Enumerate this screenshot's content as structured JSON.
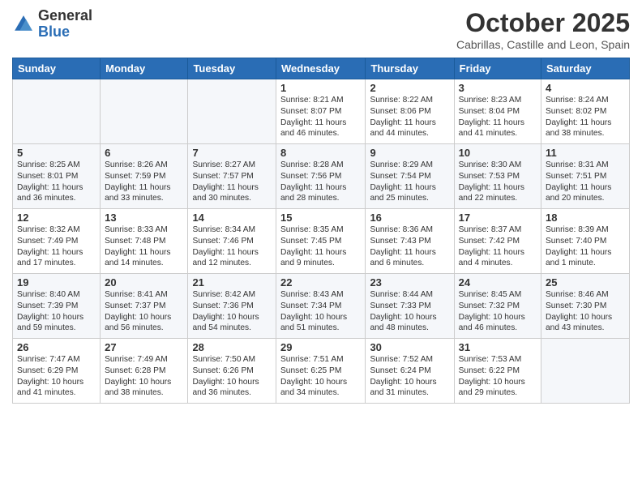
{
  "logo": {
    "general": "General",
    "blue": "Blue"
  },
  "header": {
    "title": "October 2025",
    "subtitle": "Cabrillas, Castille and Leon, Spain"
  },
  "weekdays": [
    "Sunday",
    "Monday",
    "Tuesday",
    "Wednesday",
    "Thursday",
    "Friday",
    "Saturday"
  ],
  "weeks": [
    [
      {
        "day": "",
        "info": ""
      },
      {
        "day": "",
        "info": ""
      },
      {
        "day": "",
        "info": ""
      },
      {
        "day": "1",
        "info": "Sunrise: 8:21 AM\nSunset: 8:07 PM\nDaylight: 11 hours and 46 minutes."
      },
      {
        "day": "2",
        "info": "Sunrise: 8:22 AM\nSunset: 8:06 PM\nDaylight: 11 hours and 44 minutes."
      },
      {
        "day": "3",
        "info": "Sunrise: 8:23 AM\nSunset: 8:04 PM\nDaylight: 11 hours and 41 minutes."
      },
      {
        "day": "4",
        "info": "Sunrise: 8:24 AM\nSunset: 8:02 PM\nDaylight: 11 hours and 38 minutes."
      }
    ],
    [
      {
        "day": "5",
        "info": "Sunrise: 8:25 AM\nSunset: 8:01 PM\nDaylight: 11 hours and 36 minutes."
      },
      {
        "day": "6",
        "info": "Sunrise: 8:26 AM\nSunset: 7:59 PM\nDaylight: 11 hours and 33 minutes."
      },
      {
        "day": "7",
        "info": "Sunrise: 8:27 AM\nSunset: 7:57 PM\nDaylight: 11 hours and 30 minutes."
      },
      {
        "day": "8",
        "info": "Sunrise: 8:28 AM\nSunset: 7:56 PM\nDaylight: 11 hours and 28 minutes."
      },
      {
        "day": "9",
        "info": "Sunrise: 8:29 AM\nSunset: 7:54 PM\nDaylight: 11 hours and 25 minutes."
      },
      {
        "day": "10",
        "info": "Sunrise: 8:30 AM\nSunset: 7:53 PM\nDaylight: 11 hours and 22 minutes."
      },
      {
        "day": "11",
        "info": "Sunrise: 8:31 AM\nSunset: 7:51 PM\nDaylight: 11 hours and 20 minutes."
      }
    ],
    [
      {
        "day": "12",
        "info": "Sunrise: 8:32 AM\nSunset: 7:49 PM\nDaylight: 11 hours and 17 minutes."
      },
      {
        "day": "13",
        "info": "Sunrise: 8:33 AM\nSunset: 7:48 PM\nDaylight: 11 hours and 14 minutes."
      },
      {
        "day": "14",
        "info": "Sunrise: 8:34 AM\nSunset: 7:46 PM\nDaylight: 11 hours and 12 minutes."
      },
      {
        "day": "15",
        "info": "Sunrise: 8:35 AM\nSunset: 7:45 PM\nDaylight: 11 hours and 9 minutes."
      },
      {
        "day": "16",
        "info": "Sunrise: 8:36 AM\nSunset: 7:43 PM\nDaylight: 11 hours and 6 minutes."
      },
      {
        "day": "17",
        "info": "Sunrise: 8:37 AM\nSunset: 7:42 PM\nDaylight: 11 hours and 4 minutes."
      },
      {
        "day": "18",
        "info": "Sunrise: 8:39 AM\nSunset: 7:40 PM\nDaylight: 11 hours and 1 minute."
      }
    ],
    [
      {
        "day": "19",
        "info": "Sunrise: 8:40 AM\nSunset: 7:39 PM\nDaylight: 10 hours and 59 minutes."
      },
      {
        "day": "20",
        "info": "Sunrise: 8:41 AM\nSunset: 7:37 PM\nDaylight: 10 hours and 56 minutes."
      },
      {
        "day": "21",
        "info": "Sunrise: 8:42 AM\nSunset: 7:36 PM\nDaylight: 10 hours and 54 minutes."
      },
      {
        "day": "22",
        "info": "Sunrise: 8:43 AM\nSunset: 7:34 PM\nDaylight: 10 hours and 51 minutes."
      },
      {
        "day": "23",
        "info": "Sunrise: 8:44 AM\nSunset: 7:33 PM\nDaylight: 10 hours and 48 minutes."
      },
      {
        "day": "24",
        "info": "Sunrise: 8:45 AM\nSunset: 7:32 PM\nDaylight: 10 hours and 46 minutes."
      },
      {
        "day": "25",
        "info": "Sunrise: 8:46 AM\nSunset: 7:30 PM\nDaylight: 10 hours and 43 minutes."
      }
    ],
    [
      {
        "day": "26",
        "info": "Sunrise: 7:47 AM\nSunset: 6:29 PM\nDaylight: 10 hours and 41 minutes."
      },
      {
        "day": "27",
        "info": "Sunrise: 7:49 AM\nSunset: 6:28 PM\nDaylight: 10 hours and 38 minutes."
      },
      {
        "day": "28",
        "info": "Sunrise: 7:50 AM\nSunset: 6:26 PM\nDaylight: 10 hours and 36 minutes."
      },
      {
        "day": "29",
        "info": "Sunrise: 7:51 AM\nSunset: 6:25 PM\nDaylight: 10 hours and 34 minutes."
      },
      {
        "day": "30",
        "info": "Sunrise: 7:52 AM\nSunset: 6:24 PM\nDaylight: 10 hours and 31 minutes."
      },
      {
        "day": "31",
        "info": "Sunrise: 7:53 AM\nSunset: 6:22 PM\nDaylight: 10 hours and 29 minutes."
      },
      {
        "day": "",
        "info": ""
      }
    ]
  ]
}
